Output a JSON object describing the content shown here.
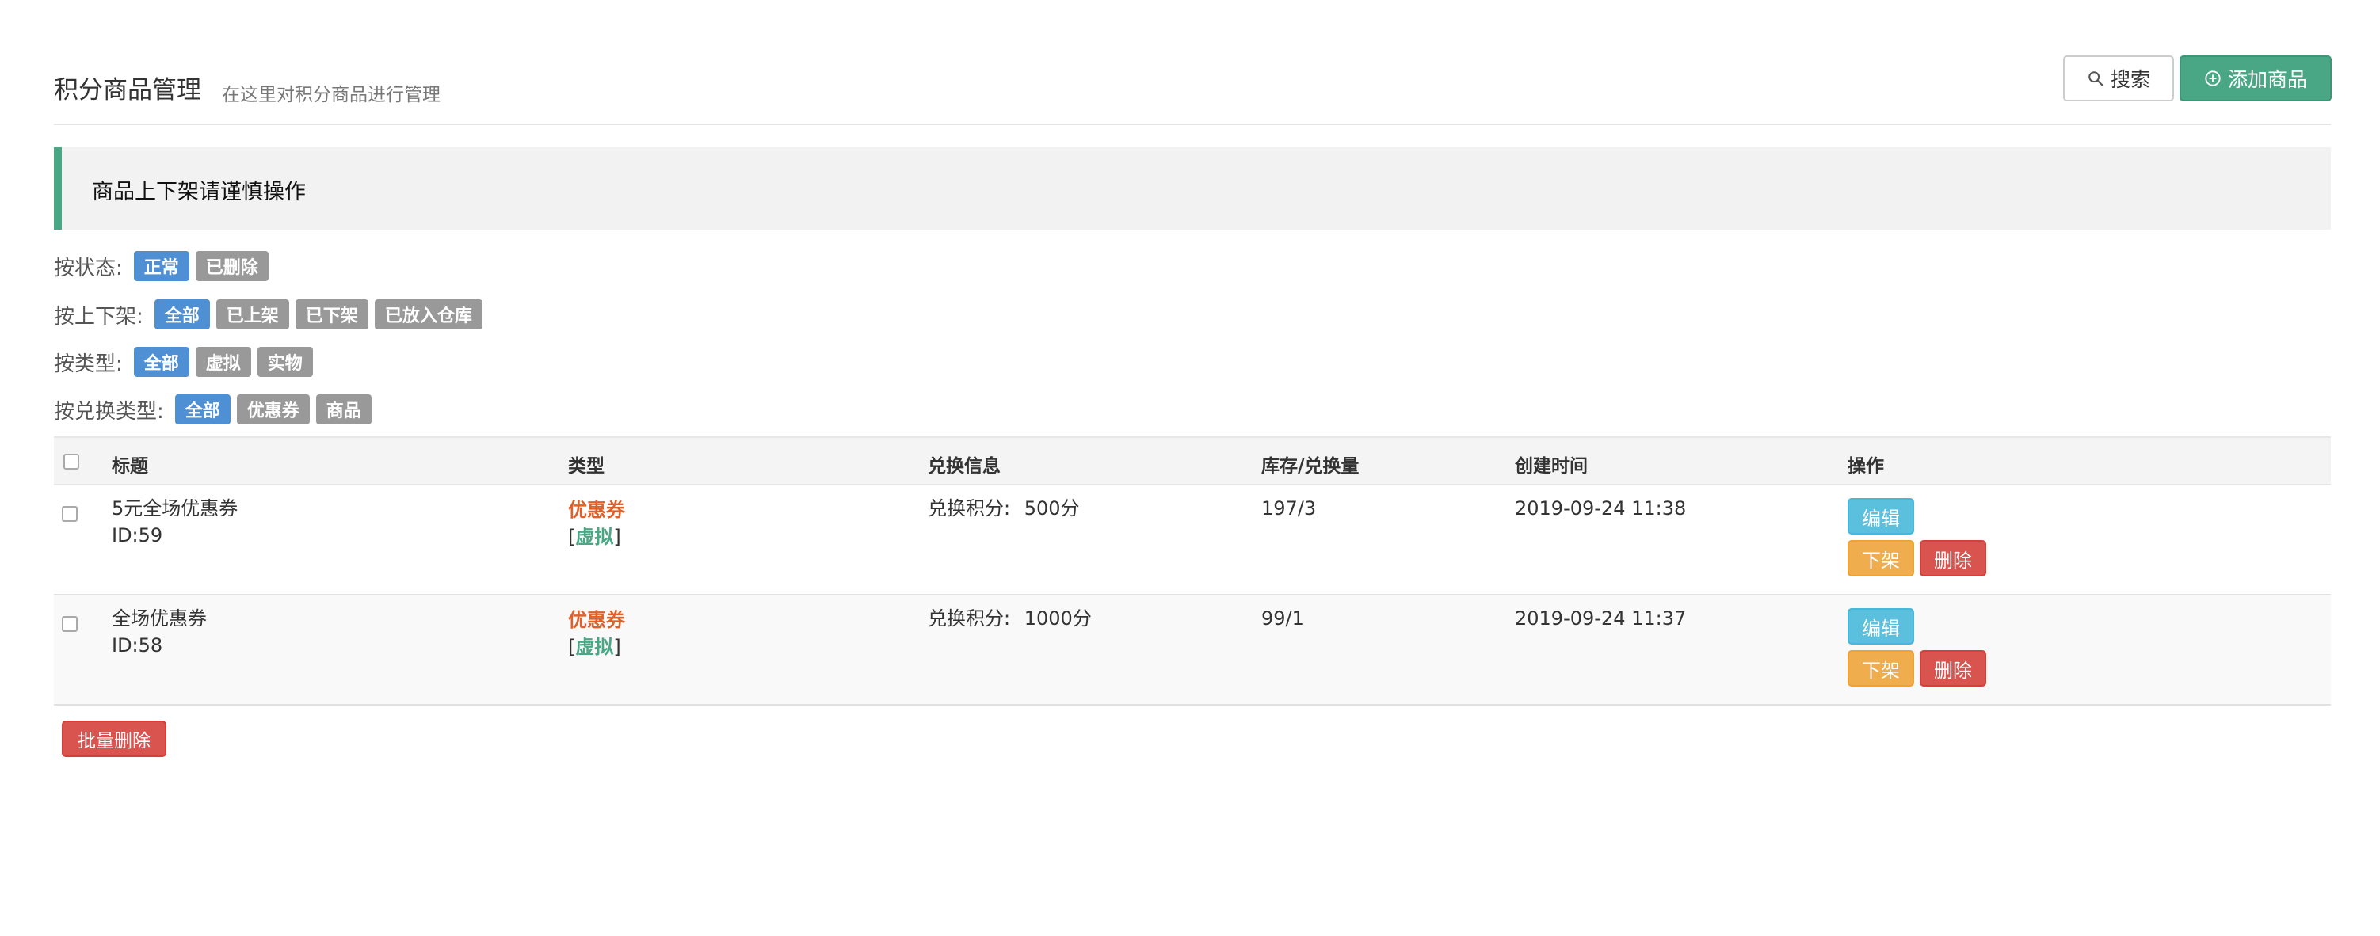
{
  "header": {
    "title": "积分商品管理",
    "subtitle": "在这里对积分商品进行管理",
    "search_label": "搜索",
    "add_label": "添加商品",
    "search_icon": "search-icon",
    "add_icon": "plus-circle-icon"
  },
  "callout": {
    "text": "商品上下架请谨慎操作"
  },
  "filters": [
    {
      "label": "按状态:",
      "options": [
        "正常",
        "已删除"
      ],
      "active": "正常"
    },
    {
      "label": "按上下架:",
      "options": [
        "全部",
        "已上架",
        "已下架",
        "已放入仓库"
      ],
      "active": "全部"
    },
    {
      "label": "按类型:",
      "options": [
        "全部",
        "虚拟",
        "实物"
      ],
      "active": "全部"
    },
    {
      "label": "按兑换类型:",
      "options": [
        "全部",
        "优惠券",
        "商品"
      ],
      "active": "全部"
    }
  ],
  "table": {
    "headers": [
      "标题",
      "类型",
      "兑换信息",
      "库存/兑换量",
      "创建时间",
      "操作"
    ],
    "rows": [
      {
        "title": "5元全场优惠券",
        "id": "ID:59",
        "type_main": "优惠券",
        "type_sub_open": "[",
        "type_sub": "虚拟",
        "type_sub_close": "]",
        "exchange_label": "兑换积分:",
        "exchange_value": "500分",
        "stock": "197/3",
        "created": "2019-09-24 11:38",
        "actions": {
          "edit": "编辑",
          "down": "下架",
          "delete": "删除"
        }
      },
      {
        "title": "全场优惠券",
        "id": "ID:58",
        "type_main": "优惠券",
        "type_sub_open": "[",
        "type_sub": "虚拟",
        "type_sub_close": "]",
        "exchange_label": "兑换积分:",
        "exchange_value": "1000分",
        "stock": "99/1",
        "created": "2019-09-24 11:37",
        "actions": {
          "edit": "编辑",
          "down": "下架",
          "delete": "删除"
        }
      }
    ]
  },
  "bulk_delete_label": "批量删除",
  "colors": {
    "primary_green": "#4aa785",
    "active_tag": "#4f8fd3",
    "inactive_tag": "#999999",
    "coupon_orange": "#e0602a",
    "edit_blue": "#5bc0de",
    "down_orange": "#f0ad4e",
    "delete_red": "#d9534f"
  }
}
